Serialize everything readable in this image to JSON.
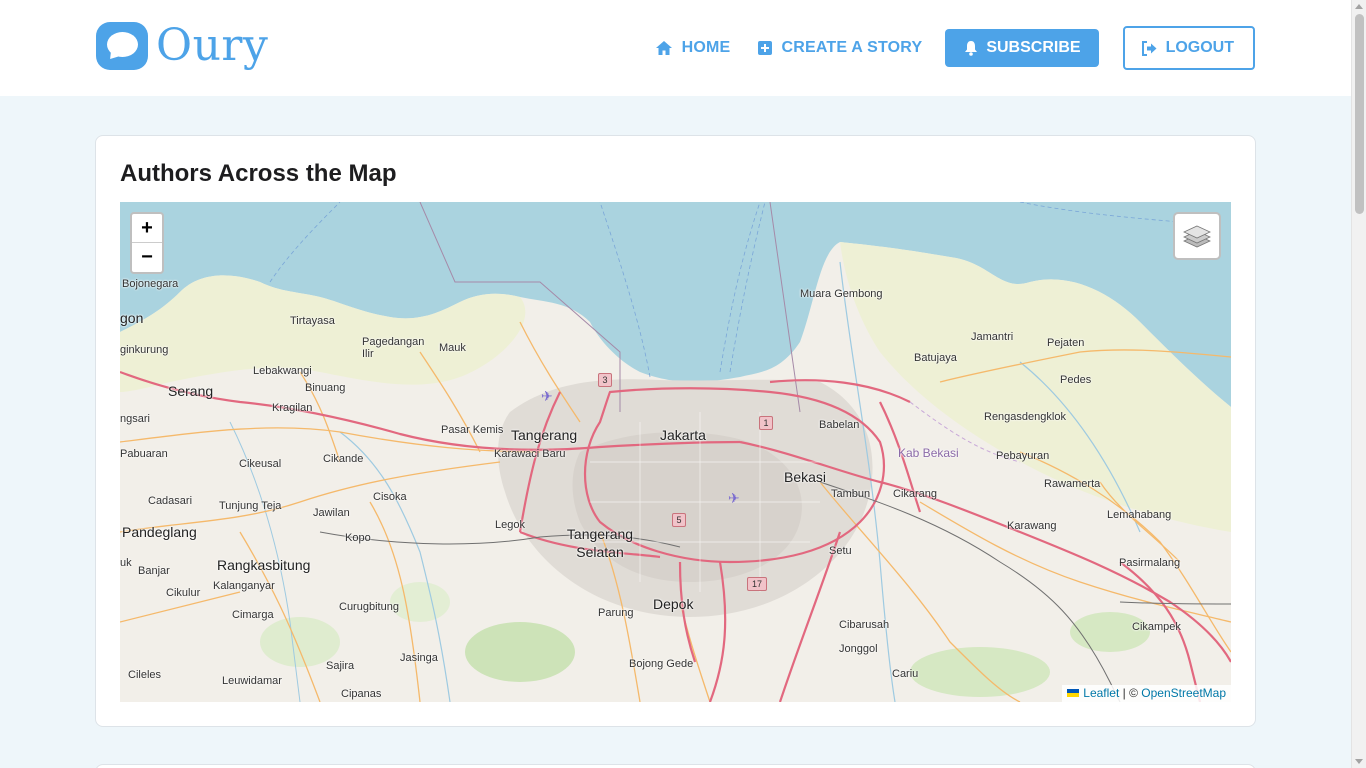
{
  "brand": {
    "name": "Oury"
  },
  "nav": {
    "home": "HOME",
    "create": "CREATE A STORY",
    "subscribe": "SUBSCRIBE",
    "logout": "LOGOUT"
  },
  "map_section": {
    "title": "Authors Across the Map",
    "zoom_in": "+",
    "zoom_out": "−",
    "attribution": {
      "leaflet": "Leaflet",
      "separator": " | © ",
      "osm": "OpenStreetMap"
    },
    "places": {
      "bojonegara": "Bojonegara",
      "gon": "gon",
      "ginkurung": "ginkurung",
      "serang": "Serang",
      "ngsari": "ngsari",
      "pabuaran": "Pabuaran",
      "cadasari": "Cadasari",
      "pandeglang": "Pandeglang",
      "uk": "uk",
      "banjar": "Banjar",
      "cikulur": "Cikulur",
      "cileles": "Cileles",
      "leuwidamar": "Leuwidamar",
      "tirtayasa": "Tirtayasa",
      "lebakwangi": "Lebakwangi",
      "kragilan": "Kragilan",
      "cikeusal": "Cikeusal",
      "tunjung_teja": "Tunjung Teja",
      "rangkasbitung": "Rangkasbitung",
      "kalanganyar": "Kalanganyar",
      "cimarga": "Cimarga",
      "sajira": "Sajira",
      "pagedangan_ilir": "Pagedangan Ilir",
      "mauk": "Mauk",
      "binuang": "Binuang",
      "cikande": "Cikande",
      "cisoka": "Cisoka",
      "jawilan": "Jawilan",
      "kopo": "Kopo",
      "curugbitung": "Curugbitung",
      "jasinga": "Jasinga",
      "cipanas": "Cipanas",
      "pasar_kemis": "Pasar Kemis",
      "tangerang": "Tangerang",
      "karawaci_baru": "Karawaci Baru",
      "legok": "Legok",
      "tangerang_selatan": "Tangerang Selatan",
      "parung": "Parung",
      "jakarta": "Jakarta",
      "depok": "Depok",
      "bojong_gede": "Bojong Gede",
      "babelan": "Babelan",
      "bekasi": "Bekasi",
      "tambun": "Tambun",
      "cikarang": "Cikarang",
      "setu": "Setu",
      "cibarusah": "Cibarusah",
      "jonggol": "Jonggol",
      "cariu": "Cariu",
      "muara_gembong": "Muara Gembong",
      "jamantri": "Jamantri",
      "pejaten": "Pejaten",
      "batujaya": "Batujaya",
      "pedes": "Pedes",
      "rengasdengklok": "Rengasdengklok",
      "kab_bekasi": "Kab Bekasi",
      "pebayuran": "Pebayuran",
      "rawamerta": "Rawamerta",
      "karawang": "Karawang",
      "lemahabang": "Lemahabang",
      "pasirmalang": "Pasirmalang",
      "cikampek": "Cikampek"
    },
    "road_shields": {
      "r3": "3",
      "r1": "1",
      "r5": "5",
      "r17": "17"
    }
  },
  "colors": {
    "accent": "#4da3e8",
    "sea": "#aad3df",
    "land": "#f2efe9",
    "motorway": "#e2687f",
    "primary_road": "#f5b96b"
  },
  "icons": [
    "home-icon",
    "plus-square-icon",
    "bell-icon",
    "sign-out-icon",
    "layers-icon",
    "airport-icon"
  ]
}
